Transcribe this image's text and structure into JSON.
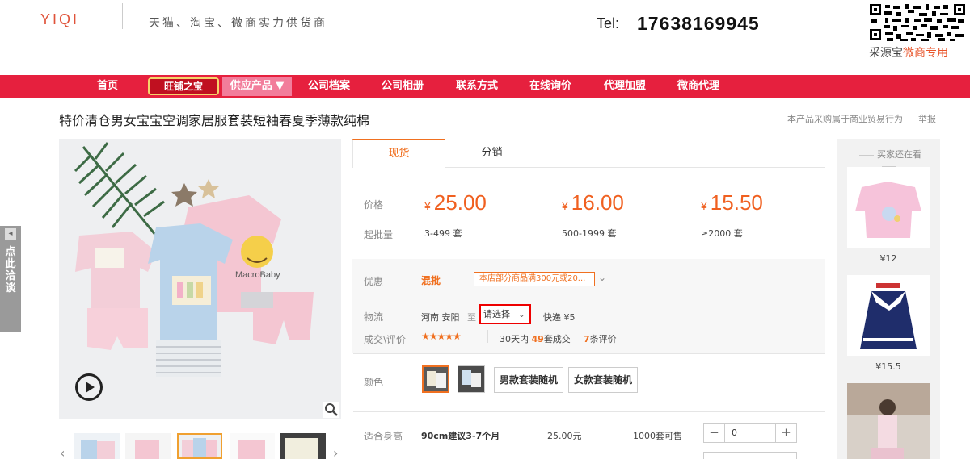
{
  "header": {
    "logo": "YIQI",
    "slogan": "天猫、淘宝、微商实力供货商",
    "tel_label": "Tel:",
    "tel_number": "17638169945",
    "qr_caption_a": "采源宝",
    "qr_caption_b": "微商专用"
  },
  "nav": {
    "items": [
      "首页",
      "旺铺之宝",
      "供应产品 ▼",
      "公司档案",
      "公司相册",
      "联系方式",
      "在线询价",
      "代理加盟",
      "微商代理"
    ]
  },
  "product": {
    "title": "特价清仓男女宝宝空调家居服套装短袖春夏季薄款纯棉",
    "notice": "本产品采购属于商业贸易行为",
    "report": "举报"
  },
  "side_float": {
    "label": "点此洽谈",
    "arrow": "◂"
  },
  "tabs": {
    "spot": "现货",
    "distribution": "分销"
  },
  "pricing": {
    "price_label": "价格",
    "moq_label": "起批量",
    "currency": "¥",
    "tiers": [
      {
        "price": "25.00",
        "qty": "3-499 套"
      },
      {
        "price": "16.00",
        "qty": "500-1999 套"
      },
      {
        "price": "15.50",
        "qty": "≥2000 套"
      }
    ]
  },
  "promo": {
    "label": "优惠",
    "mix": "混批",
    "text": "本店部分商品满300元或20...",
    "toggle": "⌄"
  },
  "logistics": {
    "label": "物流",
    "from": "河南 安阳",
    "to_word": "至",
    "select_placeholder": "请选择",
    "express": "快递 ¥5"
  },
  "deal": {
    "label": "成交\\评价",
    "stars": "★★★★★",
    "days": "30天内",
    "count": "49",
    "count_suffix": "套成交",
    "reviews": "7",
    "reviews_suffix": "条评价"
  },
  "color": {
    "label": "颜色",
    "opt_male": "男款套装随机",
    "opt_female": "女款套装随机"
  },
  "size_row": {
    "label": "适合身高",
    "size": "90cm建议3-7个月",
    "price": "25.00元",
    "stock": "1000套可售",
    "minus": "−",
    "value": "0",
    "plus": "+"
  },
  "right_col": {
    "title": "买家还在看",
    "items": [
      {
        "price": "¥12"
      },
      {
        "price": "¥15.5"
      }
    ]
  },
  "colors": {
    "brand_red": "#e6203e",
    "accent_orange": "#f07020"
  },
  "icons": [
    "play-icon",
    "zoom-icon",
    "chevron-left-icon",
    "chevron-right-icon",
    "qr-code-icon"
  ]
}
